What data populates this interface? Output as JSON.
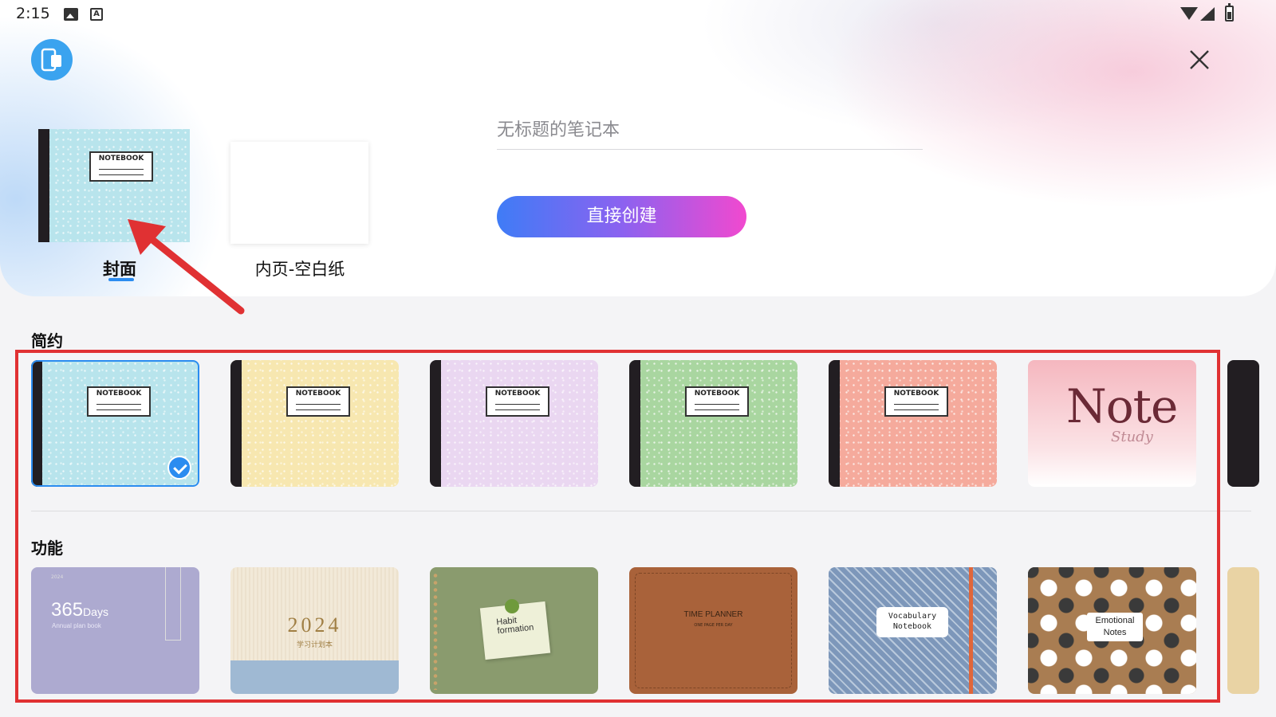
{
  "status_bar": {
    "time": "2:15",
    "icons": [
      "image-icon",
      "text-a-icon",
      "wifi-icon",
      "signal-icon",
      "battery-icon"
    ]
  },
  "header": {
    "app_icon": "tablet-icon",
    "close_icon": "close-icon"
  },
  "selector": {
    "cover_label": "NOTEBOOK",
    "tabs": [
      {
        "label": "封面",
        "active": true
      },
      {
        "label": "内页-空白纸",
        "active": false
      }
    ]
  },
  "title_input": {
    "placeholder": "无标题的笔记本",
    "value": ""
  },
  "create_button": {
    "label": "直接创建"
  },
  "sections": [
    {
      "heading": "简约",
      "covers": [
        {
          "label": "NOTEBOOK",
          "color": "#b8e4ec",
          "selected": true
        },
        {
          "label": "NOTEBOOK",
          "color": "#f7e7b0",
          "selected": false
        },
        {
          "label": "NOTEBOOK",
          "color": "#ead7f1",
          "selected": false
        },
        {
          "label": "NOTEBOOK",
          "color": "#a9d6a0",
          "selected": false
        },
        {
          "label": "NOTEBOOK",
          "color": "#f5aa9c",
          "selected": false
        },
        {
          "label_main": "Note",
          "label_sub": "Study",
          "color": "#f6c9cf",
          "selected": false
        }
      ]
    },
    {
      "heading": "功能",
      "covers": [
        {
          "number": "365",
          "unit": "Days",
          "subtitle": "Annual plan book",
          "year": "2024",
          "color": "#adaad0"
        },
        {
          "year": "2024",
          "subtitle": "学习计划本",
          "color": "#f0e6d4"
        },
        {
          "text": [
            "Habit",
            "formation"
          ],
          "color": "#8a9b6e"
        },
        {
          "title": "TIME PLANNER",
          "subtitle": "ONE PAGE PER DAY",
          "color": "#a9623a"
        },
        {
          "lines": [
            "Vocabulary",
            "Notebook"
          ],
          "color": "#7d97ba"
        },
        {
          "lines": [
            "Emotional",
            "Notes"
          ],
          "color": "#a97d52"
        }
      ]
    }
  ],
  "colors": {
    "accent": "#2b8cf0",
    "highlight_box": "#e03133",
    "button_gradient": [
      "#3f7cf6",
      "#8b62f0",
      "#f149cf"
    ]
  }
}
